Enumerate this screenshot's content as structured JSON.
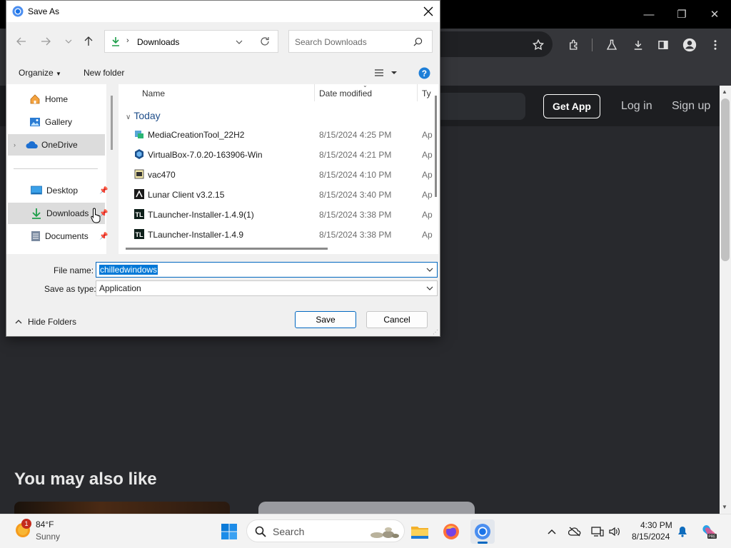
{
  "browser": {
    "window_controls": {
      "minimize": "—",
      "restore": "❐",
      "close": "✕"
    },
    "toolbar_icons": [
      "star-icon",
      "extensions-icon",
      "labs-icon",
      "download-icon",
      "sidebar-icon",
      "profile-icon",
      "menu-icon"
    ]
  },
  "page": {
    "get_app_label": "Get App",
    "login_label": "Log in",
    "signup_label": "Sign up",
    "section_heading": "You may also like"
  },
  "dialog": {
    "title": "Save As",
    "address": {
      "folder": "Downloads"
    },
    "search_placeholder": "Search Downloads",
    "organize_label": "Organize",
    "new_folder_label": "New folder",
    "nav_items": [
      {
        "label": "Home",
        "icon": "home-icon"
      },
      {
        "label": "Gallery",
        "icon": "gallery-icon"
      },
      {
        "label": "OneDrive",
        "icon": "cloud-icon"
      },
      {
        "label": "Desktop",
        "icon": "desktop-icon"
      },
      {
        "label": "Downloads",
        "icon": "download-icon"
      },
      {
        "label": "Documents",
        "icon": "documents-icon"
      }
    ],
    "columns": {
      "name": "Name",
      "date": "Date modified",
      "type": "Ty"
    },
    "group": "Today",
    "files": [
      {
        "name": "MediaCreationTool_22H2",
        "date": "8/15/2024 4:25 PM",
        "type": "Ap",
        "icon": "installer-icon"
      },
      {
        "name": "VirtualBox-7.0.20-163906-Win",
        "date": "8/15/2024 4:21 PM",
        "type": "Ap",
        "icon": "virtualbox-icon"
      },
      {
        "name": "vac470",
        "date": "8/15/2024 4:10 PM",
        "type": "Ap",
        "icon": "setup-icon"
      },
      {
        "name": "Lunar Client v3.2.15",
        "date": "8/15/2024 3:40 PM",
        "type": "Ap",
        "icon": "lunar-icon"
      },
      {
        "name": "TLauncher-Installer-1.4.9(1)",
        "date": "8/15/2024 3:38 PM",
        "type": "Ap",
        "icon": "tlauncher-icon"
      },
      {
        "name": "TLauncher-Installer-1.4.9",
        "date": "8/15/2024 3:38 PM",
        "type": "Ap",
        "icon": "tlauncher-icon"
      }
    ],
    "file_name_label": "File name:",
    "file_name_value": "chilledwindows",
    "save_type_label": "Save as type:",
    "save_type_value": "Application",
    "hide_folders_label": "Hide Folders",
    "save_label": "Save",
    "cancel_label": "Cancel"
  },
  "taskbar": {
    "weather_temp": "84°F",
    "weather_desc": "Sunny",
    "weather_badge": "1",
    "search_label": "Search",
    "time": "4:30 PM",
    "date": "8/15/2024",
    "pinned_apps": [
      "windows-start-icon",
      "file-explorer-icon",
      "firefox-icon",
      "chrome-icon"
    ]
  }
}
